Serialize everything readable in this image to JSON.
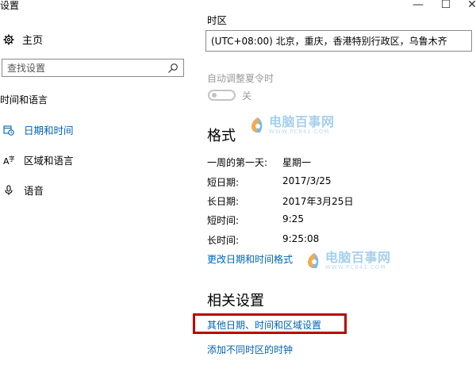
{
  "window": {
    "title": "设置",
    "minimize_glyph": "—",
    "maximize_glyph": "☐",
    "close_glyph": "✕"
  },
  "sidebar": {
    "home_label": "主页",
    "search": {
      "placeholder": "查找设置",
      "icon": "search-icon"
    },
    "section_title": "时间和语言",
    "items": [
      {
        "label": "日期和时间",
        "icon": "datetime-icon",
        "active": true
      },
      {
        "label": "区域和语言",
        "icon": "region-language-icon",
        "active": false
      },
      {
        "label": "语音",
        "icon": "microphone-icon",
        "active": false
      }
    ]
  },
  "main": {
    "timezone": {
      "label": "时区",
      "value": "(UTC+08:00) 北京，重庆，香港特别行政区，乌鲁木齐"
    },
    "dst": {
      "label": "自动调整夏令时",
      "state": "关"
    },
    "format": {
      "heading": "格式",
      "rows": [
        {
          "label": "一周的第一天:",
          "value": "星期一"
        },
        {
          "label": "短日期:",
          "value": "2017/3/25"
        },
        {
          "label": "长日期:",
          "value": "2017年3月25日"
        },
        {
          "label": "短时间:",
          "value": "9:25"
        },
        {
          "label": "长时间:",
          "value": "9:25:08"
        }
      ],
      "change_link": "更改日期和时间格式"
    },
    "related": {
      "heading": "相关设置",
      "links": [
        "其他日期、时间和区域设置",
        "添加不同时区的时钟"
      ]
    }
  },
  "watermark": {
    "main": "电脑百事网",
    "sub": "WWW.PC841.COM"
  },
  "colors": {
    "accent": "#0063b1",
    "highlight": "#c00000",
    "disabled": "#9a9a9a"
  }
}
